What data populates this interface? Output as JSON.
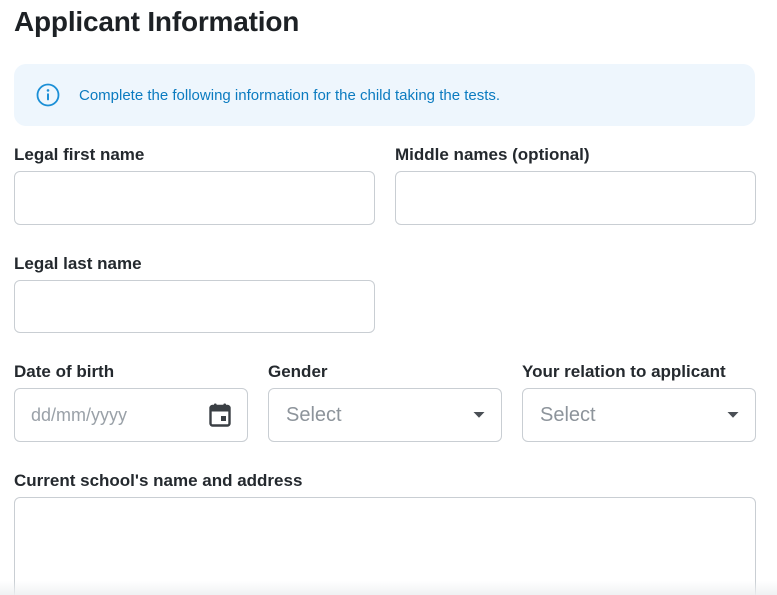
{
  "page": {
    "title": "Applicant Information"
  },
  "info_banner": {
    "icon": "info-circle-icon",
    "text": "Complete the following information for the child taking the tests.",
    "background": "#eef6fd",
    "color": "#0b7bc0"
  },
  "form": {
    "first_name": {
      "label": "Legal first name",
      "value": ""
    },
    "middle_names": {
      "label": "Middle names (optional)",
      "value": ""
    },
    "last_name": {
      "label": "Legal last name",
      "value": ""
    },
    "date_of_birth": {
      "label": "Date of birth",
      "placeholder": "dd/mm/yyyy",
      "icon": "calendar-icon"
    },
    "gender": {
      "label": "Gender",
      "selected": "Select",
      "icon": "caret-down-icon"
    },
    "relation": {
      "label": "Your relation to applicant",
      "selected": "Select",
      "icon": "caret-down-icon"
    },
    "school": {
      "label": "Current school's name and address",
      "value": ""
    }
  }
}
